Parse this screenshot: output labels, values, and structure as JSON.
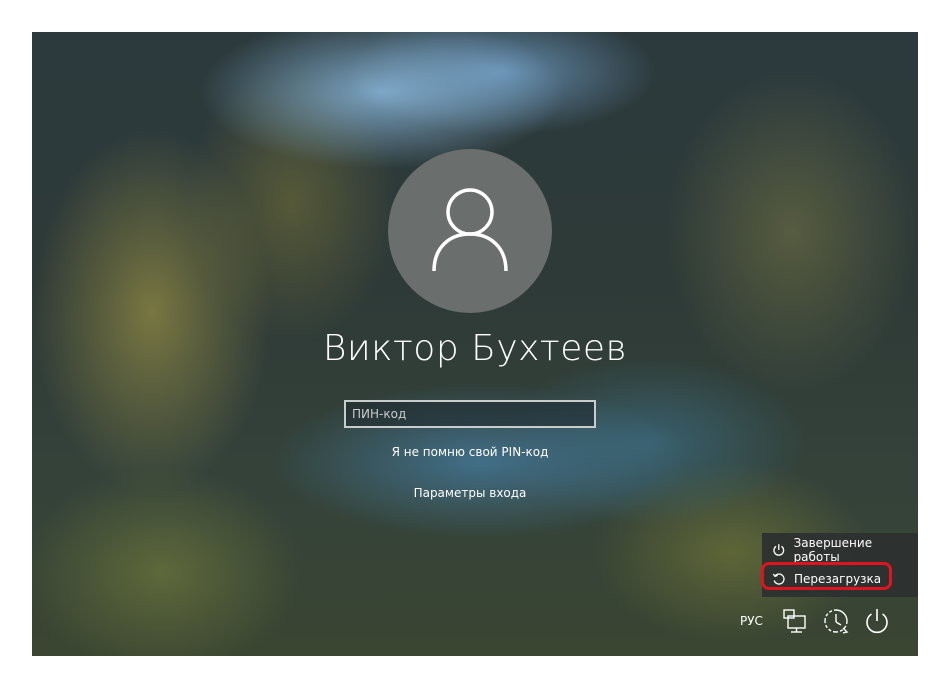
{
  "user": {
    "name": "Виктор Бухтеев",
    "avatar_icon": "user-icon"
  },
  "signin": {
    "pin_placeholder": "ПИН-код",
    "pin_value": "",
    "forgot_pin_link": "Я не помню свой PIN-код",
    "signin_options_link": "Параметры входа"
  },
  "power_menu": {
    "items": [
      {
        "label": "Завершение работы",
        "icon": "power-icon"
      },
      {
        "label": "Перезагрузка",
        "icon": "restart-icon",
        "highlighted": true
      }
    ],
    "highlight_color": "#e0141e"
  },
  "tray": {
    "language": "РУС",
    "icons": [
      "network-icon",
      "ease-of-access-icon",
      "power-icon"
    ]
  }
}
